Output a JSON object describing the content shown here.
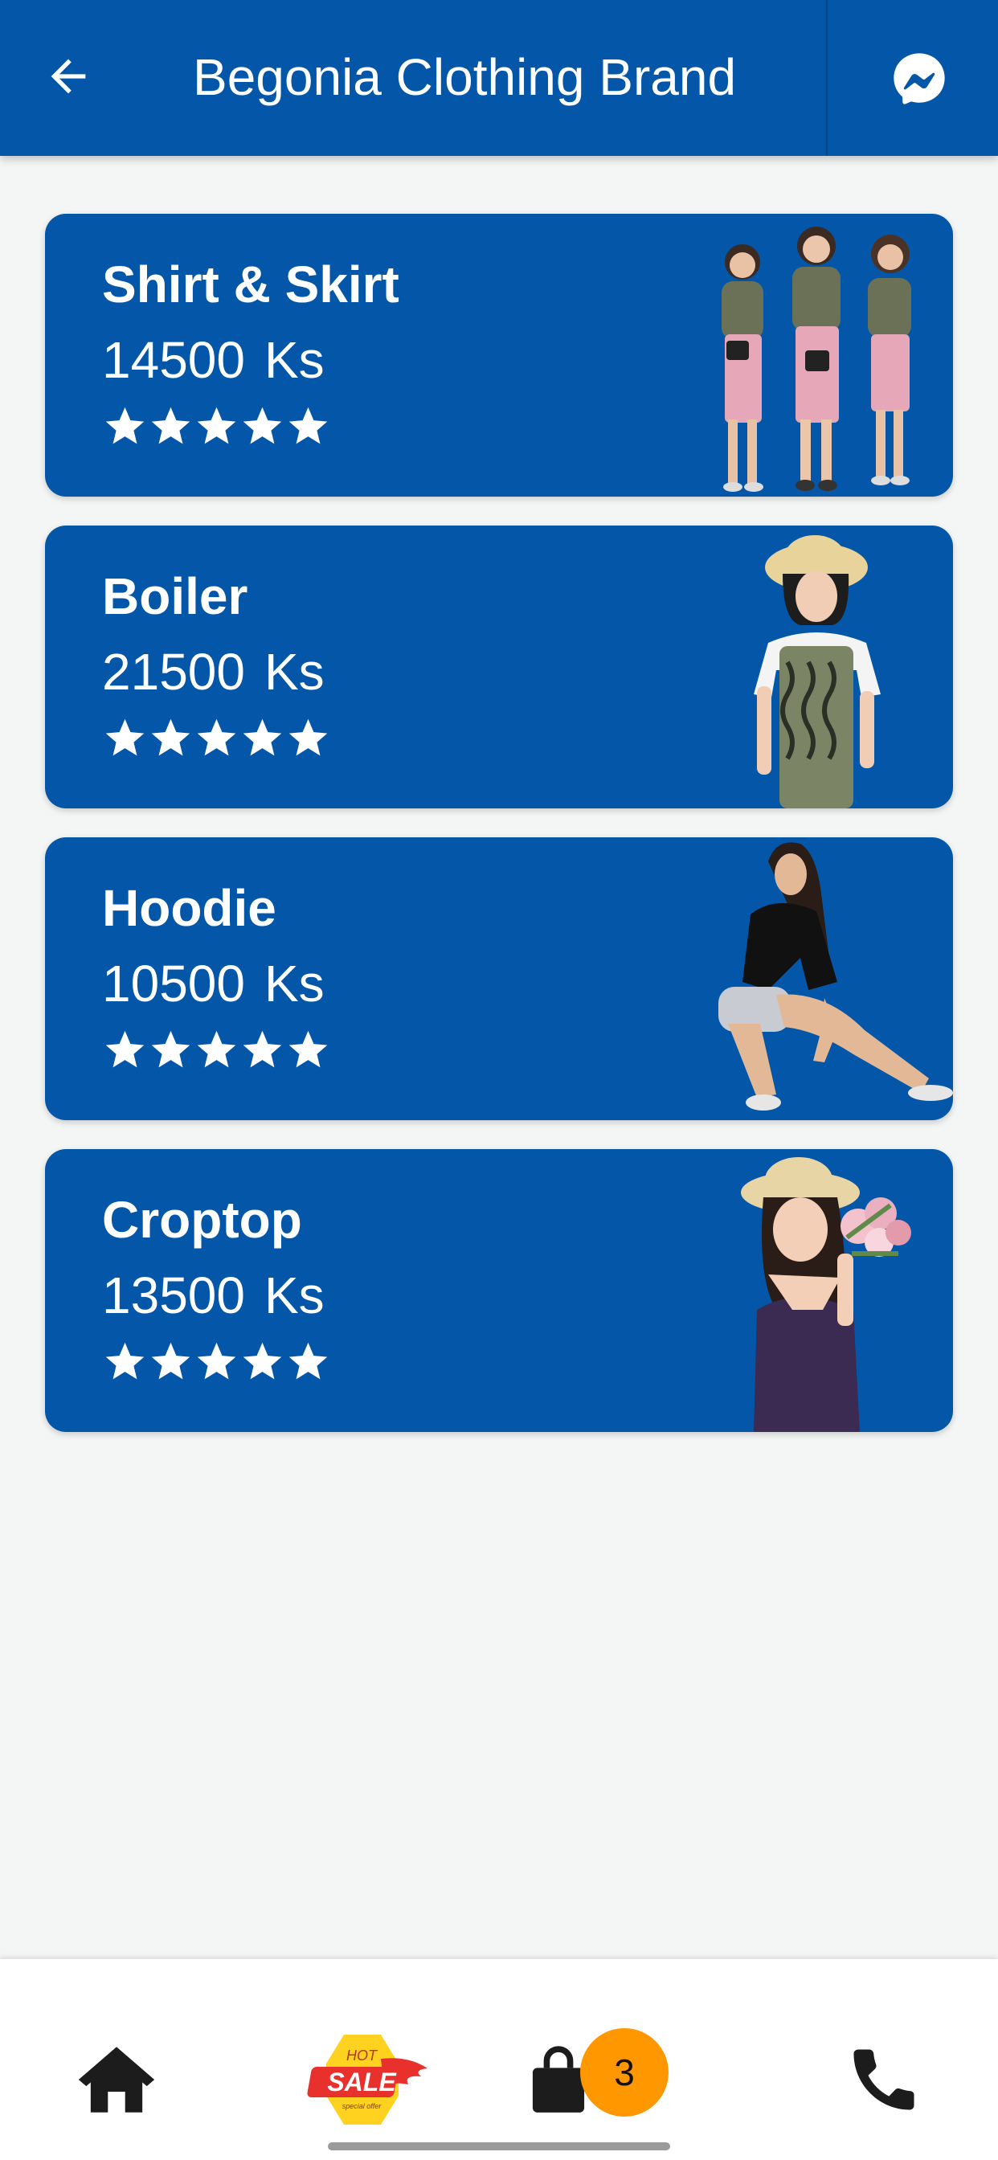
{
  "header": {
    "title": "Begonia Clothing Brand",
    "back_icon": "arrow-left-icon",
    "action_icon": "messenger-icon",
    "background_color": "#0457a8"
  },
  "products": [
    {
      "name": "Shirt & Skirt",
      "price": "14500",
      "currency": "Ks",
      "rating": 5,
      "image": "three-women-shirt-skirt-photo"
    },
    {
      "name": "Boiler",
      "price": "21500",
      "currency": "Ks",
      "rating": 5,
      "image": "woman-overalls-hat-photo"
    },
    {
      "name": "Hoodie",
      "price": "10500",
      "currency": "Ks",
      "rating": 5,
      "image": "woman-black-hoodie-sitting-photo"
    },
    {
      "name": "Croptop",
      "price": "13500",
      "currency": "Ks",
      "rating": 5,
      "image": "woman-croptop-flowers-photo"
    }
  ],
  "bottom_nav": {
    "items": [
      {
        "icon": "home-icon"
      },
      {
        "icon": "hot-sale-icon",
        "sticker_text": [
          "HOT",
          "SALE",
          "special offer"
        ]
      },
      {
        "icon": "shopping-bag-icon",
        "badge": "3"
      },
      {
        "icon": "phone-icon"
      }
    ],
    "badge_color": "#ff9700"
  },
  "colors": {
    "card": "#0457a8",
    "page_background": "#f4f6f6"
  }
}
